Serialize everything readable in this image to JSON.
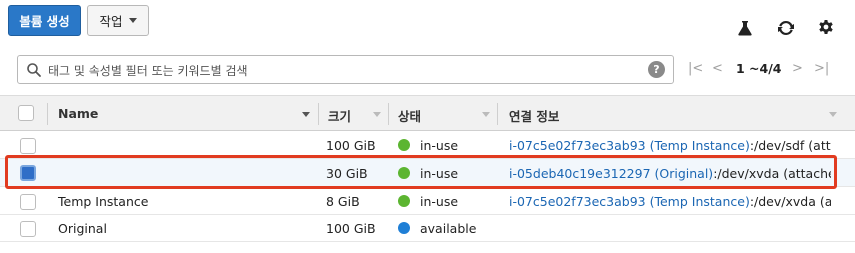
{
  "toolbar": {
    "create_label": "볼륨 생성",
    "actions_label": "작업",
    "icons": [
      "flask-icon",
      "refresh-icon",
      "gear-icon"
    ]
  },
  "search": {
    "placeholder": "태그 및 속성별 필터 또는 키워드별 검색",
    "help": "?"
  },
  "pagination": {
    "text": "1 ~4/4"
  },
  "table": {
    "columns": [
      "Name",
      "크기",
      "상태",
      "연결 정보"
    ],
    "rows": [
      {
        "name": "",
        "size": "100 GiB",
        "status": "in-use",
        "status_color": "#5cb531",
        "attach_link": "i-07c5e02f73ec3ab93 (Temp Instance)",
        "attach_rest": ":/dev/sdf (attac…",
        "checked": false
      },
      {
        "name": "",
        "size": "30 GiB",
        "status": "in-use",
        "status_color": "#5cb531",
        "attach_link": "i-05deb40c19e312297 (Original)",
        "attach_rest": ":/dev/xvda (attached)",
        "checked": true
      },
      {
        "name": "Temp Instance",
        "size": "8 GiB",
        "status": "in-use",
        "status_color": "#5cb531",
        "attach_link": "i-07c5e02f73ec3ab93 (Temp Instance)",
        "attach_rest": ":/dev/xvda (attac…",
        "checked": false
      },
      {
        "name": "Original",
        "size": "100 GiB",
        "status": "available",
        "status_color": "#1f7fd6",
        "attach_link": "",
        "attach_rest": "",
        "checked": false
      }
    ]
  }
}
